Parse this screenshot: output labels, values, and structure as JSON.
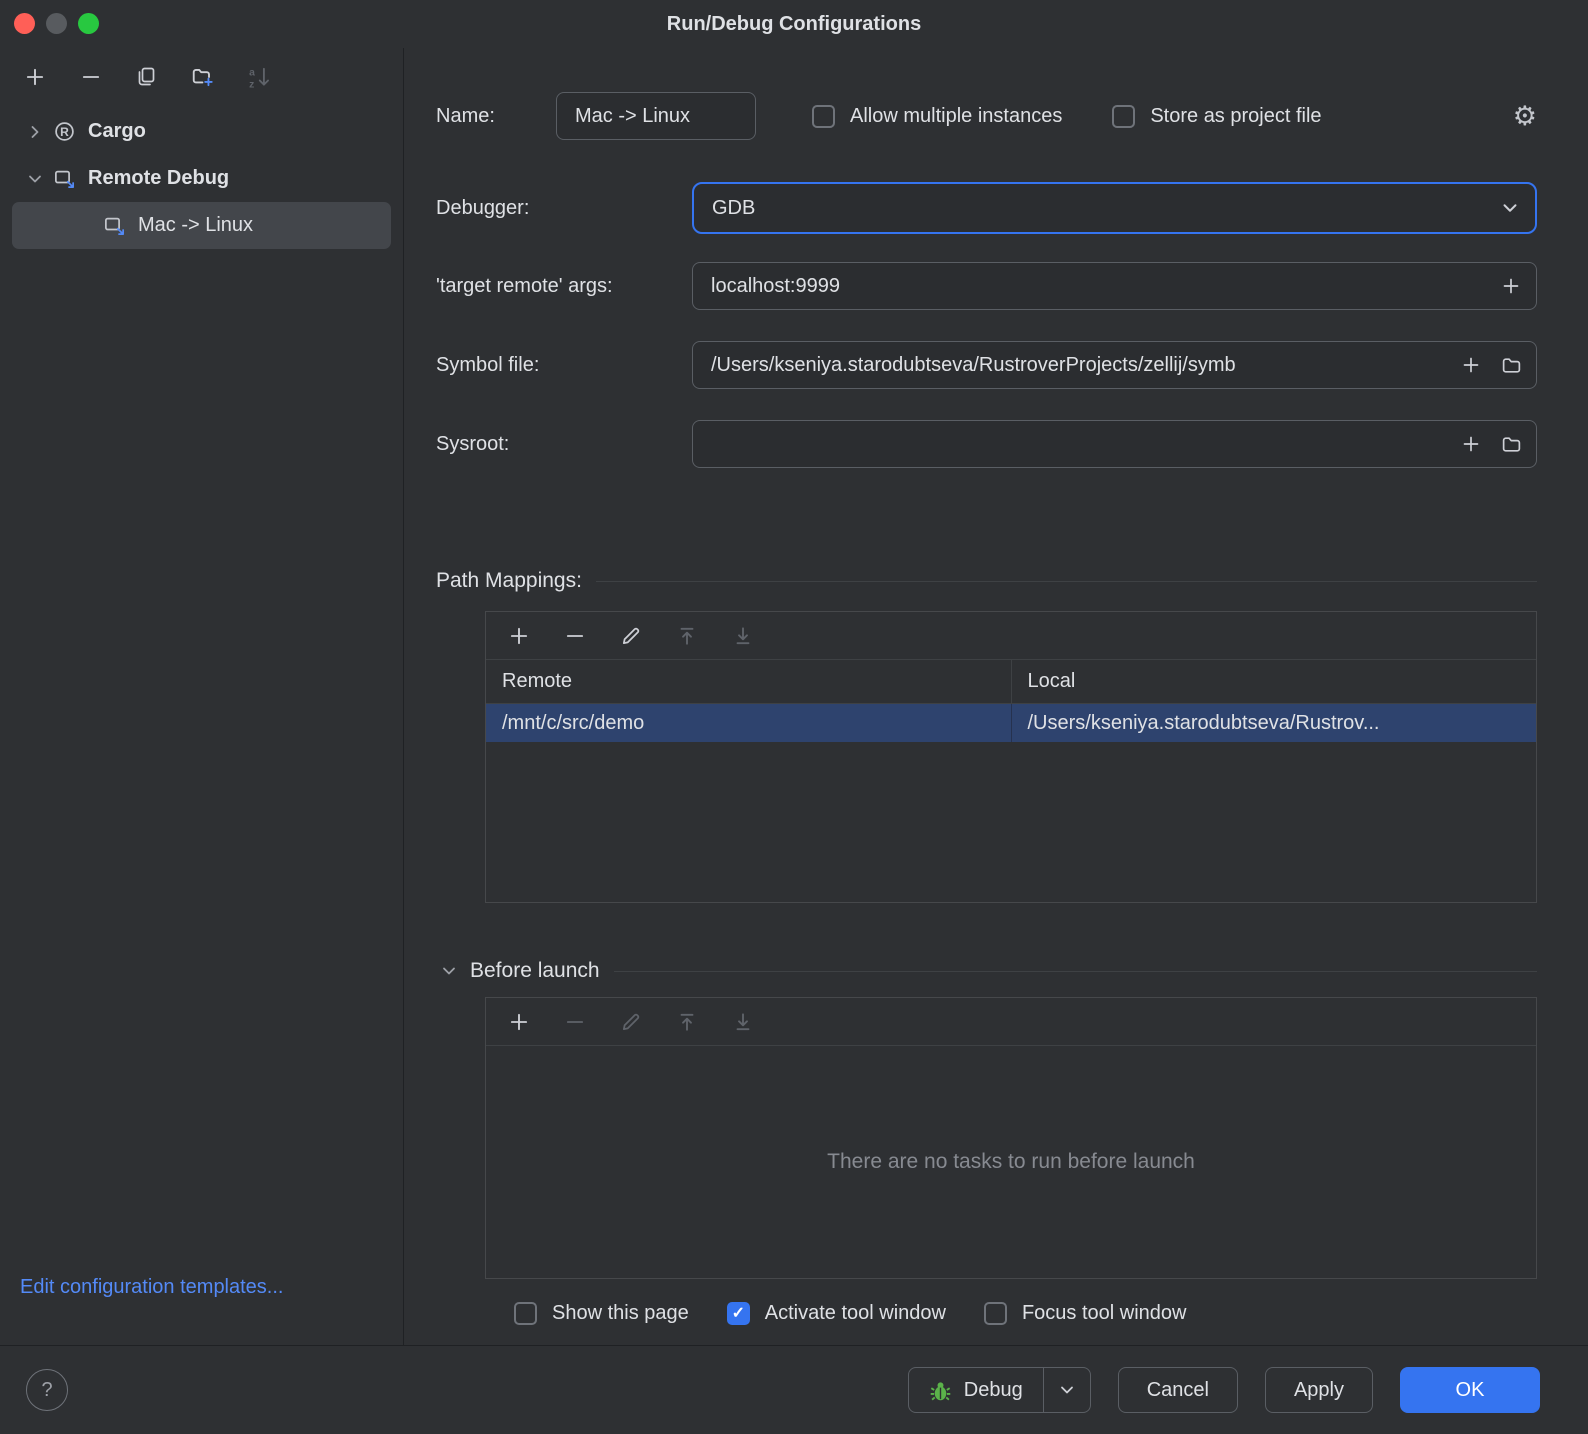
{
  "window": {
    "title": "Run/Debug Configurations"
  },
  "sidebar": {
    "tree": {
      "cargo": "Cargo",
      "remote_debug": "Remote Debug",
      "mac_linux": "Mac -> Linux"
    },
    "edit_templates": "Edit configuration templates..."
  },
  "form": {
    "name_label": "Name:",
    "name_value": "Mac -> Linux",
    "allow_multiple": "Allow multiple instances",
    "store_project": "Store as project file",
    "debugger_label": "Debugger:",
    "debugger_value": "GDB",
    "target_args_label": "'target remote' args:",
    "target_args_value": "localhost:9999",
    "symbol_label": "Symbol file:",
    "symbol_value": "/Users/kseniya.starodubtseva/RustroverProjects/zellij/symb",
    "sysroot_label": "Sysroot:",
    "sysroot_value": ""
  },
  "path_mappings": {
    "title": "Path Mappings:",
    "columns": {
      "remote": "Remote",
      "local": "Local"
    },
    "rows": [
      {
        "remote": "/mnt/c/src/demo",
        "local": "/Users/kseniya.starodubtseva/Rustrov..."
      }
    ]
  },
  "before_launch": {
    "title": "Before launch",
    "empty_text": "There are no tasks to run before launch"
  },
  "options": {
    "show_page": {
      "label": "Show this page",
      "checked": false
    },
    "activate_tool": {
      "label": "Activate tool window",
      "checked": true
    },
    "focus_tool": {
      "label": "Focus tool window",
      "checked": false
    }
  },
  "footer": {
    "help": "?",
    "debug": "Debug",
    "cancel": "Cancel",
    "apply": "Apply",
    "ok": "OK"
  },
  "colors": {
    "accent": "#3574F0",
    "selection": "#2E436E",
    "link": "#548AF7",
    "tree_selection": "#43464B"
  },
  "icons": {
    "gear": "⚙",
    "help": "?",
    "check": "✓"
  }
}
